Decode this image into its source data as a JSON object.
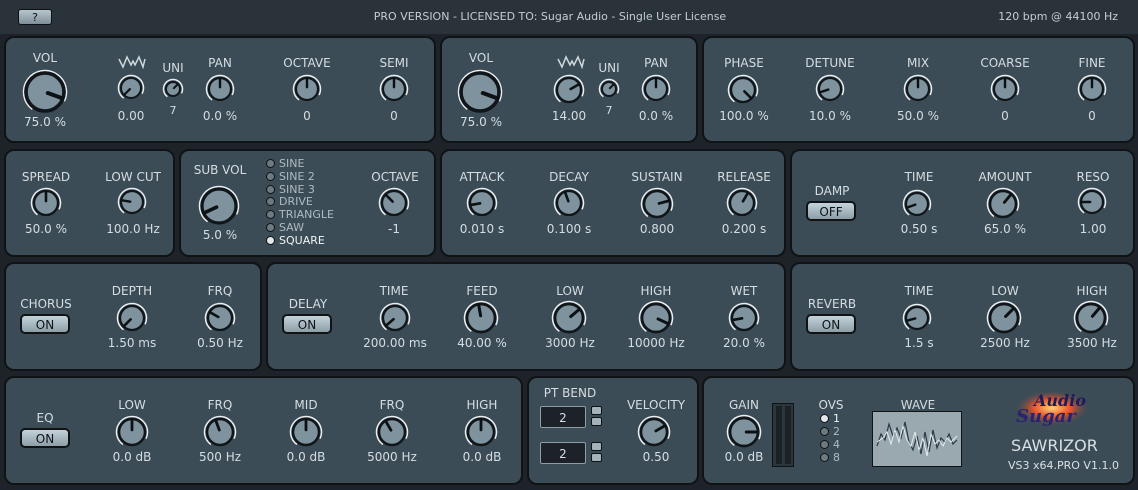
{
  "header": {
    "help_label": "?",
    "license": "PRO VERSION - LICENSED TO: Sugar Audio - Single User License",
    "tempo": "120 bpm @ 44100 Hz"
  },
  "osc1": {
    "vol_label": "VOL",
    "vol_value": "75.0 %",
    "detune_value": "0.00",
    "uni_label": "UNI",
    "uni_value": "7",
    "pan_label": "PAN",
    "pan_value": "0.0 %",
    "octave_label": "OCTAVE",
    "octave_value": "0",
    "semi_label": "SEMI",
    "semi_value": "0"
  },
  "osc2": {
    "vol_label": "VOL",
    "vol_value": "75.0 %",
    "detune_value": "14.00",
    "uni_label": "UNI",
    "uni_value": "7",
    "pan_label": "PAN",
    "pan_value": "0.0 %"
  },
  "osc2b": {
    "phase_label": "PHASE",
    "phase_value": "100.0 %",
    "detune_label": "DETUNE",
    "detune_value": "10.0 %",
    "mix_label": "MIX",
    "mix_value": "50.0 %",
    "coarse_label": "COARSE",
    "coarse_value": "0",
    "fine_label": "FINE",
    "fine_value": "0"
  },
  "spread": {
    "spread_label": "SPREAD",
    "spread_value": "50.0 %",
    "lowcut_label": "LOW CUT",
    "lowcut_value": "100.0 Hz"
  },
  "sub": {
    "vol_label": "SUB VOL",
    "vol_value": "5.0 %",
    "waves": [
      "SINE",
      "SINE 2",
      "SINE 3",
      "DRIVE",
      "TRIANGLE",
      "SAW",
      "SQUARE"
    ],
    "selected_wave": "SQUARE",
    "octave_label": "OCTAVE",
    "octave_value": "-1"
  },
  "env": {
    "attack_label": "ATTACK",
    "attack_value": "0.010 s",
    "decay_label": "DECAY",
    "decay_value": "0.100 s",
    "sustain_label": "SUSTAIN",
    "sustain_value": "0.800",
    "release_label": "RELEASE",
    "release_value": "0.200 s"
  },
  "damp": {
    "label": "DAMP",
    "toggle": "OFF",
    "time_label": "TIME",
    "time_value": "0.50 s",
    "amount_label": "AMOUNT",
    "amount_value": "65.0 %",
    "reso_label": "RESO",
    "reso_value": "1.00"
  },
  "chorus": {
    "label": "CHORUS",
    "toggle": "ON",
    "depth_label": "DEPTH",
    "depth_value": "1.50 ms",
    "frq_label": "FRQ",
    "frq_value": "0.50 Hz"
  },
  "delay": {
    "label": "DELAY",
    "toggle": "ON",
    "time_label": "TIME",
    "time_value": "200.00 ms",
    "feed_label": "FEED",
    "feed_value": "40.00 %",
    "low_label": "LOW",
    "low_value": "3000 Hz",
    "high_label": "HIGH",
    "high_value": "10000 Hz",
    "wet_label": "WET",
    "wet_value": "20.0 %"
  },
  "reverb": {
    "label": "REVERB",
    "toggle": "ON",
    "time_label": "TIME",
    "time_value": "1.5 s",
    "low_label": "LOW",
    "low_value": "2500 Hz",
    "high_label": "HIGH",
    "high_value": "3500 Hz"
  },
  "eq": {
    "label": "EQ",
    "toggle": "ON",
    "low_label": "LOW",
    "low_value": "0.0 dB",
    "frq1_label": "FRQ",
    "frq1_value": "500 Hz",
    "mid_label": "MID",
    "mid_value": "0.0 dB",
    "frq2_label": "FRQ",
    "frq2_value": "5000 Hz",
    "high_label": "HIGH",
    "high_value": "0.0 dB"
  },
  "pitch": {
    "label": "PT BEND",
    "up_value": "2",
    "down_value": "2",
    "velocity_label": "VELOCITY",
    "velocity_value": "0.50"
  },
  "output": {
    "gain_label": "GAIN",
    "gain_value": "0.0 dB",
    "ovs_label": "OVS",
    "ovs_options": [
      "1",
      "2",
      "4",
      "8"
    ],
    "ovs_selected": "1",
    "wave_label": "WAVE"
  },
  "brand": {
    "logo_text": "Audio Sugar",
    "product": "SAWRIZOR",
    "version": "VS3 x64.PRO V1.1.0"
  },
  "colors": {
    "panel": "#3c4c56",
    "background": "#1d2328",
    "knob_body": "#7f939e",
    "text": "#d5dde2"
  }
}
